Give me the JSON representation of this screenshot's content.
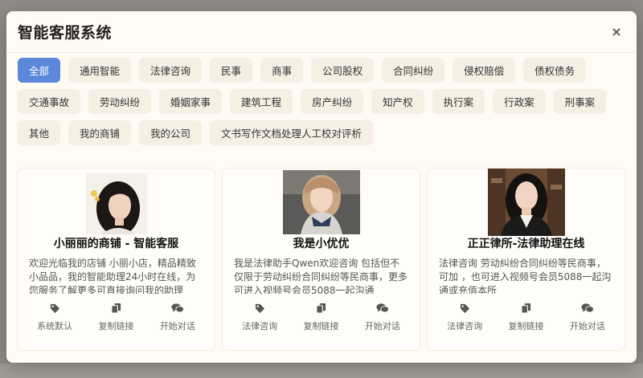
{
  "modal": {
    "title": "智能客服系统",
    "close_label": "×"
  },
  "tabs": [
    {
      "label": "全部",
      "active": true
    },
    {
      "label": "通用智能"
    },
    {
      "label": "法律咨询"
    },
    {
      "label": "民事"
    },
    {
      "label": "商事"
    },
    {
      "label": "公司股权"
    },
    {
      "label": "合同纠纷"
    },
    {
      "label": "侵权赔偿"
    },
    {
      "label": "债权债务"
    },
    {
      "label": "交通事故"
    },
    {
      "label": "劳动纠纷"
    },
    {
      "label": "婚姻家事"
    },
    {
      "label": "建筑工程"
    },
    {
      "label": "房产纠纷"
    },
    {
      "label": "知产权"
    },
    {
      "label": "执行案"
    },
    {
      "label": "行政案"
    },
    {
      "label": "刑事案"
    },
    {
      "label": "其他"
    },
    {
      "label": "我的商铺"
    },
    {
      "label": "我的公司"
    },
    {
      "label": "文书写作文档处理人工校对评析"
    }
  ],
  "cards": [
    {
      "name": "小丽丽的商铺 - 智能客服",
      "description": "欢迎光临我的店铺 小丽小店，精品精致小品品，我的智能助理24小时在线，为您服务了解更多可直接询问我的助理",
      "actions": {
        "tag": "系统默认",
        "copy": "复制链接",
        "chat": "开始对话"
      }
    },
    {
      "name": "我是小优优",
      "description": "我是法律助手Qwen欢迎咨询 包括但不仅限于劳动纠纷合同纠纷等民商事，更多可进入视频号会员5088一起沟通",
      "actions": {
        "tag": "法律咨询",
        "copy": "复制链接",
        "chat": "开始对话"
      }
    },
    {
      "name": "正正律所-法律助理在线",
      "description": "法律咨询 劳动纠纷合同纠纷等民商事，可加 ，也可进入视频号会员5088一起沟通或充值本所",
      "actions": {
        "tag": "法律咨询",
        "copy": "复制链接",
        "chat": "开始对话"
      }
    }
  ],
  "colors": {
    "active_tab": "#5b88d8",
    "tab_bg": "#f6efe4",
    "modal_bg": "#fffaf3"
  },
  "icons": {
    "tag": "tag-icon",
    "copy": "copy-icon",
    "chat": "chat-bubbles-icon",
    "close": "close-icon"
  }
}
